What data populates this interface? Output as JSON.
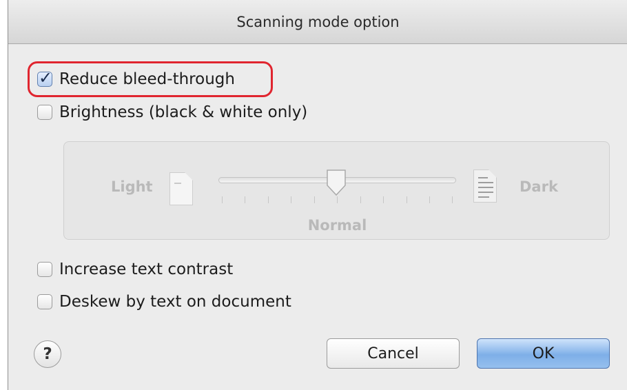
{
  "dialog": {
    "title": "Scanning mode option",
    "options": {
      "reduce_bleed": {
        "label": "Reduce bleed-through",
        "checked": true
      },
      "brightness": {
        "label": "Brightness (black & white only)",
        "checked": false
      },
      "increase_contrast": {
        "label": "Increase text contrast",
        "checked": false
      },
      "deskew": {
        "label": "Deskew by text on document",
        "checked": false
      }
    },
    "brightness_slider": {
      "left_label": "Light",
      "right_label": "Dark",
      "center_label": "Normal",
      "value": 0.5,
      "enabled": false,
      "tick_count": 11
    },
    "buttons": {
      "help": "?",
      "cancel": "Cancel",
      "ok": "OK"
    },
    "colors": {
      "highlight": "#e0252f",
      "default_button": "#7eafe8"
    },
    "icons": {
      "light": "light-document-icon",
      "dark": "dark-document-icon"
    }
  }
}
